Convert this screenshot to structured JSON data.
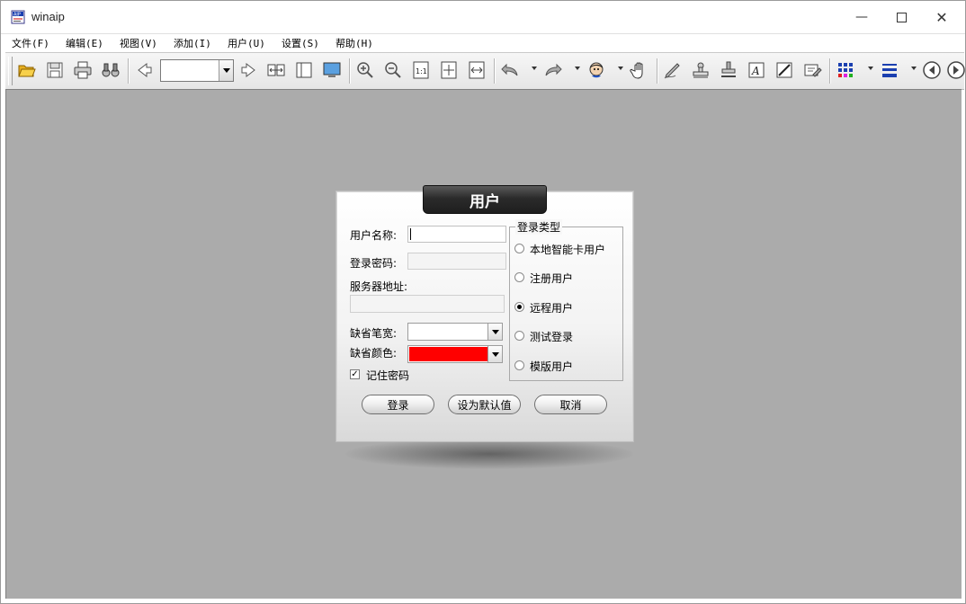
{
  "window": {
    "title": "winaip"
  },
  "menu": [
    "文件(F)",
    "编辑(E)",
    "视图(V)",
    "添加(I)",
    "用户(U)",
    "设置(S)",
    "帮助(H)"
  ],
  "toolbar": {
    "page_value": ""
  },
  "dialog": {
    "title": "用户",
    "username_label": "用户名称:",
    "username_value": "",
    "password_label": "登录密码:",
    "password_value": "",
    "server_label": "服务器地址:",
    "server_value": "",
    "pen_width_label": "缺省笔宽:",
    "pen_width_value": "",
    "color_label": "缺省颜色:",
    "color_value": "#ff0000",
    "remember_label": "记住密码",
    "remember_checked": true,
    "login_type": {
      "title": "登录类型",
      "options": [
        "本地智能卡用户",
        "注册用户",
        "远程用户",
        "测试登录",
        "模版用户"
      ],
      "selected": "远程用户"
    },
    "buttons": {
      "login": "登录",
      "set_default": "设为默认值",
      "cancel": "取消"
    }
  },
  "colors": {
    "workspace": "#ababab",
    "dialog_header": "#2b2b2b",
    "accent_red": "#ff0000"
  }
}
